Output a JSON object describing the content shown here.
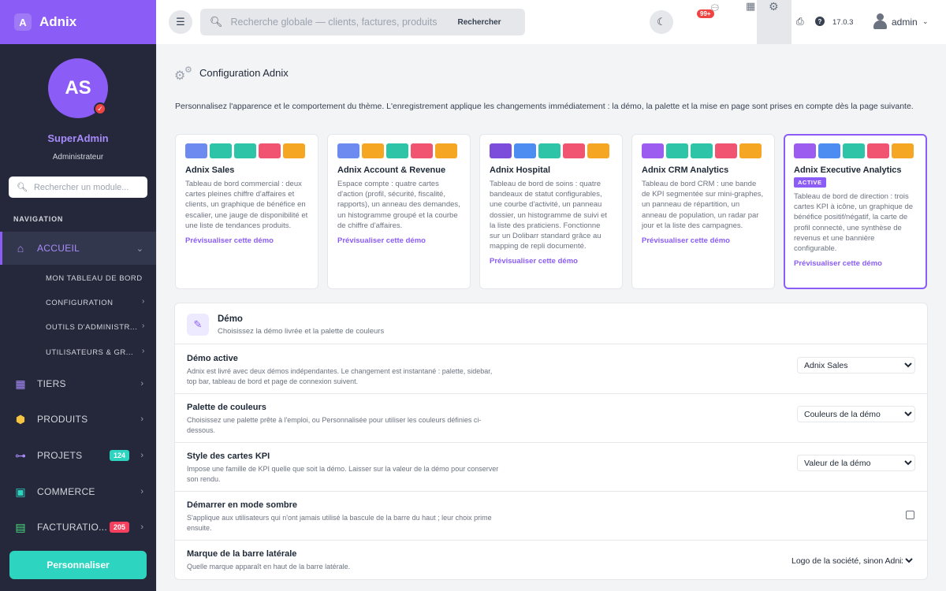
{
  "brand": {
    "logo_letter": "A",
    "name": "Adnix"
  },
  "profile": {
    "initials": "AS",
    "name": "SuperAdmin",
    "role": "Administrateur"
  },
  "sidebar": {
    "search_placeholder": "Rechercher un module...",
    "nav_label": "NAVIGATION",
    "home": {
      "label": "ACCUEIL",
      "icon": "home-icon"
    },
    "sub_items": [
      {
        "label": "MON TABLEAU DE BORD"
      },
      {
        "label": "CONFIGURATION"
      },
      {
        "label": "OUTILS D'ADMINISTR..."
      },
      {
        "label": "UTILISATEURS & GR..."
      }
    ],
    "items": [
      {
        "label": "TIERS",
        "icon": "building-icon"
      },
      {
        "label": "PRODUITS",
        "icon": "box-icon"
      },
      {
        "label": "PROJETS",
        "icon": "project-icon",
        "count": "124",
        "count_color": "#2dd4bf"
      },
      {
        "label": "COMMERCE",
        "icon": "briefcase-icon"
      },
      {
        "label": "FACTURATIO...",
        "icon": "invoice-icon",
        "count": "205",
        "count_color": "#f43f5e"
      }
    ],
    "customize_label": "Personnaliser"
  },
  "topbar": {
    "search_placeholder": "Recherche globale — clients, factures, produits",
    "search_button": "Rechercher",
    "messages_count": "99+",
    "version": "17.0.3",
    "username": "admin"
  },
  "page": {
    "title": "Configuration Adnix",
    "description": "Personnalisez l'apparence et le comportement du thème. L'enregistrement applique les changements immédiatement : la démo, la palette et la mise en page sont prises en compte dès la page suivante."
  },
  "demos": [
    {
      "title": "Adnix Sales",
      "active": false,
      "swatches": [
        "#6d8af0",
        "#2dc4a8",
        "#2dc4a8",
        "#f05470",
        "#f5a623"
      ],
      "description": "Tableau de bord commercial : deux cartes pleines chiffre d'affaires et clients, un graphique de bénéfice en escalier, une jauge de disponibilité et une liste de tendances produits.",
      "link": "Prévisualiser cette démo"
    },
    {
      "title": "Adnix Account & Revenue",
      "active": false,
      "swatches": [
        "#6d8af0",
        "#f5a623",
        "#2dc4a8",
        "#f05470",
        "#f5a623"
      ],
      "description": "Espace compte : quatre cartes d'action (profil, sécurité, fiscalité, rapports), un anneau des demandes, un histogramme groupé et la courbe de chiffre d'affaires.",
      "link": "Prévisualiser cette démo"
    },
    {
      "title": "Adnix Hospital",
      "active": false,
      "swatches": [
        "#7c4ddb",
        "#4d8cf0",
        "#2dc4a8",
        "#f05470",
        "#f5a623"
      ],
      "description": "Tableau de bord de soins : quatre bandeaux de statut configurables, une courbe d'activité, un panneau dossier, un histogramme de suivi et la liste des praticiens. Fonctionne sur un Dolibarr standard grâce au mapping de repli documenté.",
      "link": "Prévisualiser cette démo"
    },
    {
      "title": "Adnix CRM Analytics",
      "active": false,
      "swatches": [
        "#9c5cf0",
        "#2dc4a8",
        "#2dc4a8",
        "#f05470",
        "#f5a623"
      ],
      "description": "Tableau de bord CRM : une bande de KPI segmentée sur mini-graphes, un panneau de répartition, un anneau de population, un radar par jour et la liste des campagnes.",
      "link": "Prévisualiser cette démo"
    },
    {
      "title": "Adnix Executive Analytics",
      "active": true,
      "badge": "ACTIVE",
      "swatches": [
        "#9c5cf0",
        "#4d8cf0",
        "#2dc4a8",
        "#f05470",
        "#f5a623"
      ],
      "description": "Tableau de bord de direction : trois cartes KPI à icône, un graphique de bénéfice positif/négatif, la carte de profil connecté, une synthèse de revenus et une bannière configurable.",
      "link": "Prévisualiser cette démo"
    }
  ],
  "panel": {
    "title": "Démo",
    "subtitle": "Choisissez la démo livrée et la palette de couleurs",
    "settings": [
      {
        "label": "Démo active",
        "help": "Adnix est livré avec deux démos indépendantes. Le changement est instantané : palette, sidebar, top bar, tableau de bord et page de connexion suivent.",
        "value": "Adnix Sales"
      },
      {
        "label": "Palette de couleurs",
        "help": "Choisissez une palette prête à l'emploi, ou Personnalisée pour utiliser les couleurs définies ci-dessous.",
        "value": "Couleurs de la démo"
      },
      {
        "label": "Style des cartes KPI",
        "help": "Impose une famille de KPI quelle que soit la démo. Laisser sur la valeur de la démo pour conserver son rendu.",
        "value": "Valeur de la démo"
      },
      {
        "label": "Démarrer en mode sombre",
        "help": "S'applique aux utilisateurs qui n'ont jamais utilisé la bascule de la barre du haut ; leur choix prime ensuite.",
        "checked": false
      },
      {
        "label": "Marque de la barre latérale",
        "help": "Quelle marque apparaît en haut de la barre latérale.",
        "value": "Logo de la société, sinon Adnix"
      }
    ]
  }
}
